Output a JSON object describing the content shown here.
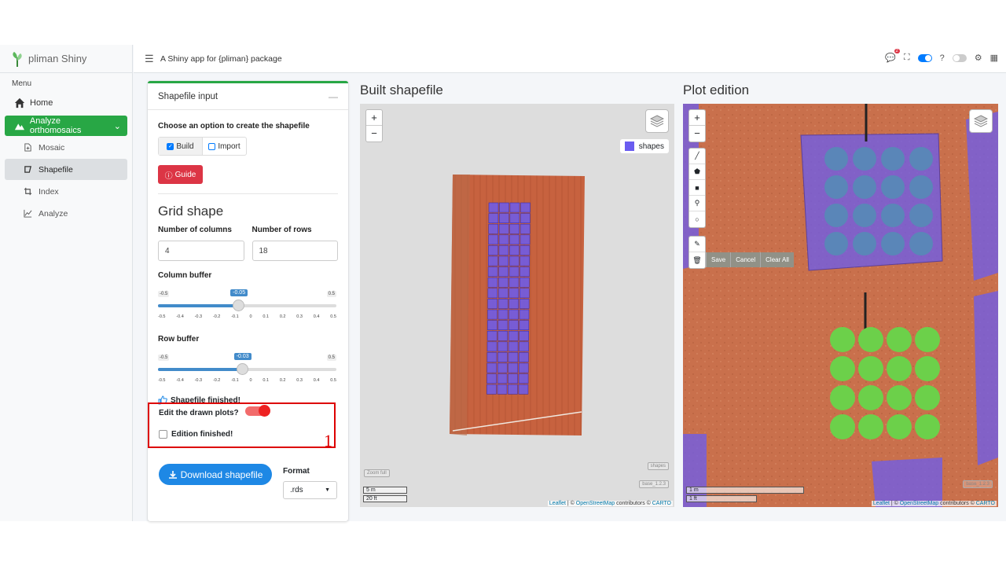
{
  "brand": {
    "name": "pliman Shiny"
  },
  "sidebar": {
    "menu_title": "Menu",
    "home": "Home",
    "group": "Analyze orthomosaics",
    "items": [
      {
        "label": "Mosaic"
      },
      {
        "label": "Shapefile"
      },
      {
        "label": "Index"
      },
      {
        "label": "Analyze"
      }
    ]
  },
  "header": {
    "title": "A Shiny app for {pliman} package",
    "notification_count": "2"
  },
  "shapefile_card": {
    "title": "Shapefile input",
    "option_label": "Choose an option to create the shapefile",
    "options": [
      "Build",
      "Import"
    ],
    "selected_option": "Build",
    "guide_label": "Guide",
    "grid_title": "Grid shape",
    "columns_label": "Number of columns",
    "columns_value": "4",
    "rows_label": "Number of rows",
    "rows_value": "18",
    "column_buffer": {
      "label": "Column buffer",
      "min": "-0.5",
      "max": "0.5",
      "value": "-0.05",
      "fraction": 0.45
    },
    "row_buffer": {
      "label": "Row buffer",
      "min": "-0.5",
      "max": "0.5",
      "value": "-0.03",
      "fraction": 0.47
    },
    "ticks": [
      "-0.5",
      "-0.4",
      "-0.3",
      "-0.2",
      "-0.1",
      "0",
      "0.1",
      "0.2",
      "0.3",
      "0.4",
      "0.5"
    ],
    "finished_text": "Shapefile finished!",
    "edit_label": "Edit the drawn plots?",
    "edit_finished_label": "Edition finished!",
    "annotation_number": "1",
    "download_label": "Download shapefile",
    "format_label": "Format",
    "format_value": ".rds"
  },
  "built_map": {
    "title": "Built shapefile",
    "legend": "shapes",
    "zoom_full": "Zoom full",
    "layer_shapes": "shapes",
    "layer_base": "base_1.2.3",
    "scale_m": "5 m",
    "scale_ft": "20 ft",
    "attribution": [
      "Leaflet",
      " | © ",
      "OpenStreetMap",
      " contributors © ",
      "CARTO"
    ]
  },
  "edit_map": {
    "title": "Plot edition",
    "actions": [
      "Save",
      "Cancel",
      "Clear All"
    ],
    "layer_base": "base_1.2.3",
    "scale_m": "1 m",
    "scale_ft": "1 ft",
    "attribution": [
      "Leaflet",
      " | © ",
      "OpenStreetMap",
      " contributors © ",
      "CARTO"
    ]
  },
  "colors": {
    "accent_green": "#28a745",
    "polygon": "#6a5cf0",
    "soil": "#c9704c",
    "highlight": "#dd0000"
  }
}
